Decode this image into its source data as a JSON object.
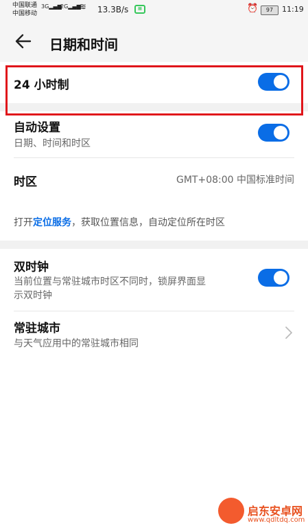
{
  "status_bar": {
    "carrier1": "中国联通",
    "carrier2": "中国移动",
    "sig1": "3G",
    "sig2": "2G",
    "speed": "13.3B/s",
    "battery": "97",
    "time": "11:19"
  },
  "header": {
    "title": "日期和时间"
  },
  "rows": {
    "h24": {
      "label": "24 小时制",
      "enabled": true
    },
    "auto": {
      "label": "自动设置",
      "sub": "日期、时间和时区",
      "enabled": true
    },
    "timezone": {
      "label": "时区",
      "value": "GMT+08:00 中国标准时间"
    },
    "location_note": {
      "prefix": "打开",
      "link": "定位服务",
      "suffix": "，获取位置信息，自动定位所在时区"
    },
    "dual_clock": {
      "label": "双时钟",
      "sub_line1": "当前位置与常驻城市时区不同时，锁屏界面显",
      "sub_line2": "示双时钟",
      "enabled": true
    },
    "home_city": {
      "label": "常驻城市",
      "sub": "与天气应用中的常驻城市相同"
    }
  },
  "watermark": {
    "title": "启东安卓网",
    "url": "www.qdltdq.com"
  },
  "colors": {
    "accent": "#0a6de6",
    "highlight": "#e0151a"
  }
}
